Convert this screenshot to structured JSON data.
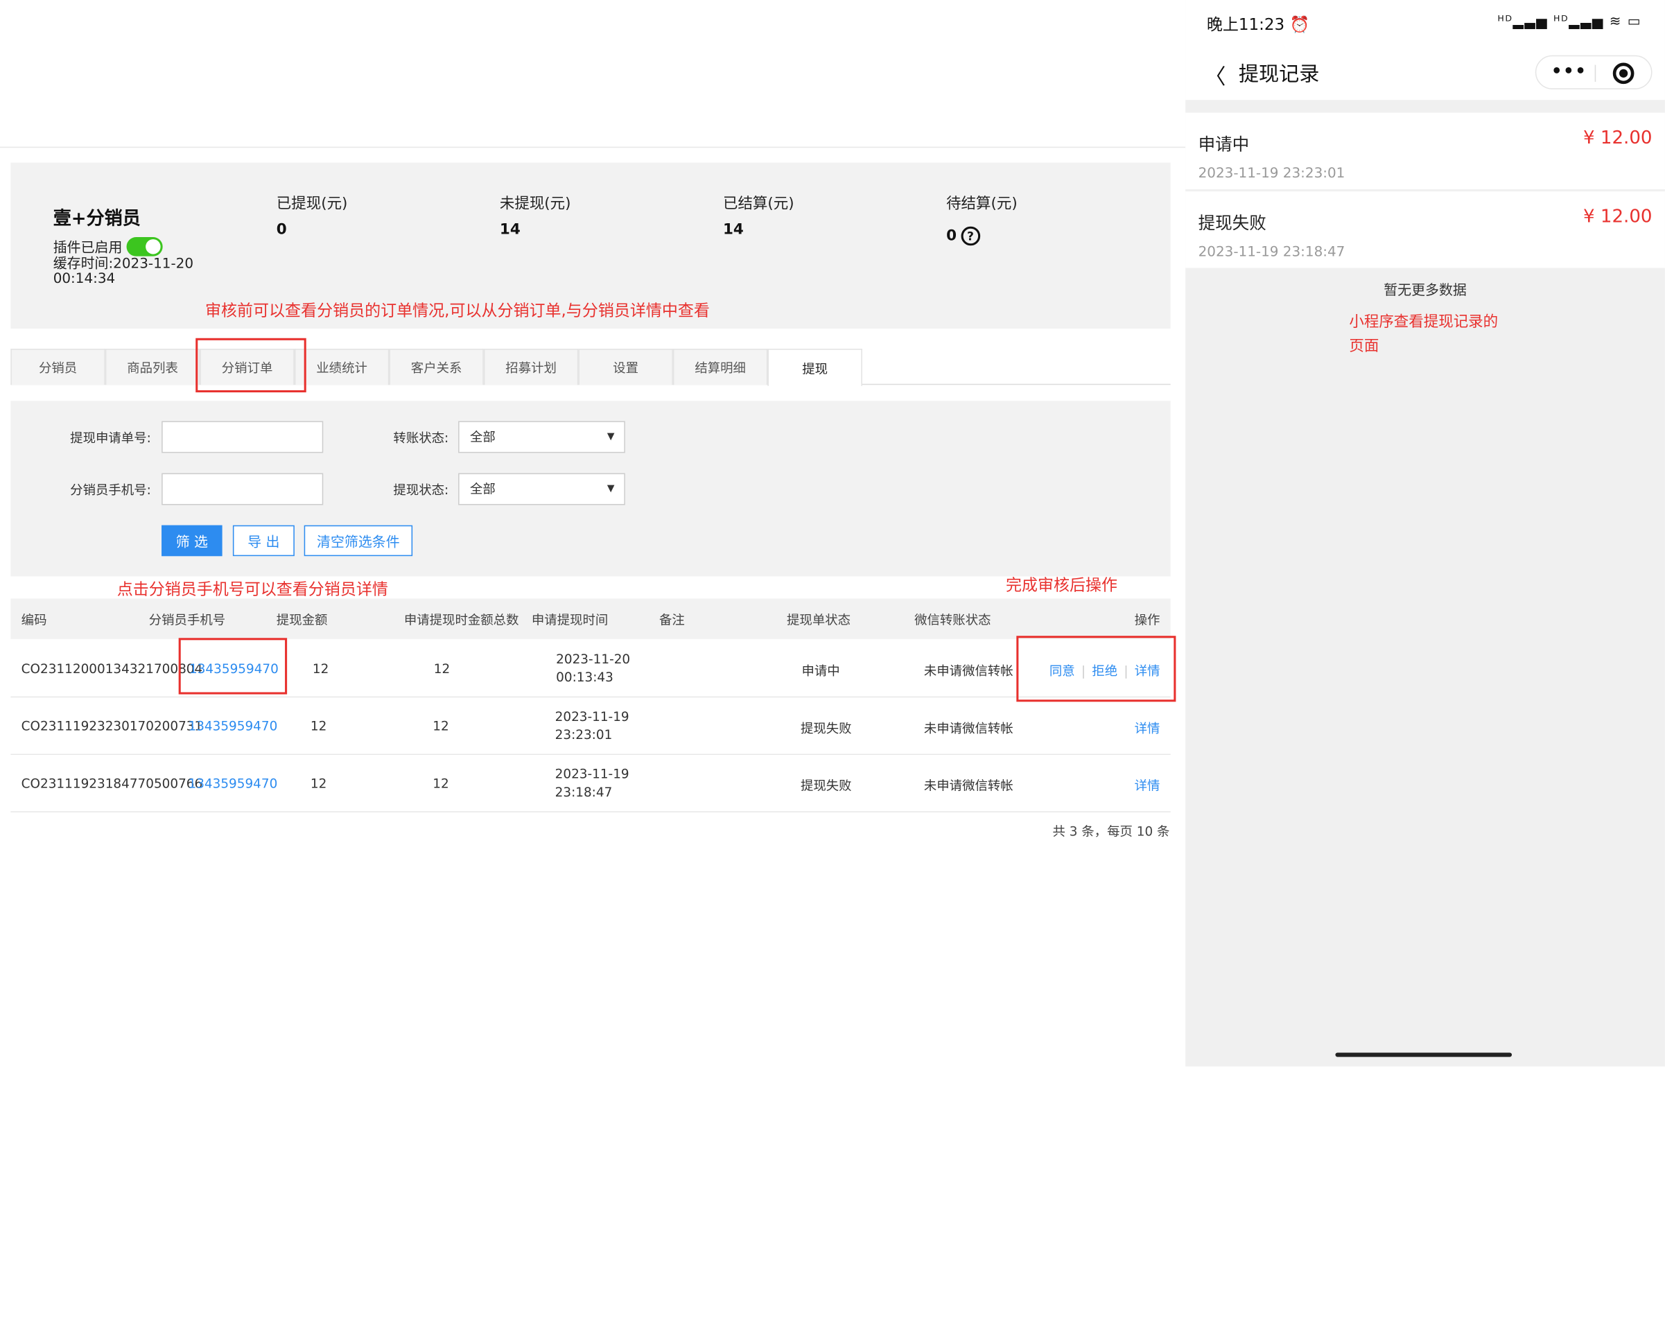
{
  "header": {
    "title": "壹+分销员",
    "plugin_label": "插件已启用",
    "plugin_enabled": true,
    "cache_time": "缓存时间:2023-11-20 00:14:34",
    "stats": [
      {
        "label": "已提现(元)",
        "value": "0"
      },
      {
        "label": "未提现(元)",
        "value": "14"
      },
      {
        "label": "已结算(元)",
        "value": "14"
      },
      {
        "label": "待结算(元)",
        "value": "0"
      }
    ]
  },
  "annotations": {
    "top_note": "审核前可以查看分销员的订单情况,可以从分销订单,与分销员详情中查看",
    "phone_note": "点击分销员手机号可以查看分销员详情",
    "action_note": "完成审核后操作",
    "mini_note_line1": "小程序查看提现记录的",
    "mini_note_line2": "页面"
  },
  "tabs": [
    "分销员",
    "商品列表",
    "分销订单",
    "业绩统计",
    "客户关系",
    "招募计划",
    "设置",
    "结算明细",
    "提现"
  ],
  "active_tab": "提现",
  "filter": {
    "apply_no_label": "提现申请单号:",
    "phone_label": "分销员手机号:",
    "transfer_status_label": "转账状态:",
    "transfer_status_value": "全部",
    "withdraw_status_label": "提现状态:",
    "withdraw_status_value": "全部",
    "btn_filter": "筛 选",
    "btn_export": "导 出",
    "btn_clear": "清空筛选条件"
  },
  "table": {
    "columns": [
      "编码",
      "分销员手机号",
      "提现金额",
      "申请提现时金额总数",
      "申请提现时间",
      "备注",
      "提现单状态",
      "微信转账状态",
      "操作"
    ],
    "rows": [
      {
        "code": "CO23112000134321700804",
        "phone": "13435959470",
        "amount": "12",
        "total": "12",
        "date": "2023-11-20",
        "time": "00:13:43",
        "remark": "",
        "status": "申请中",
        "wx_status": "未申请微信转帐",
        "actions": [
          "同意",
          "拒绝",
          "详情"
        ]
      },
      {
        "code": "CO23111923230170200731",
        "phone": "13435959470",
        "amount": "12",
        "total": "12",
        "date": "2023-11-19",
        "time": "23:23:01",
        "remark": "",
        "status": "提现失败",
        "wx_status": "未申请微信转帐",
        "actions": [
          "详情"
        ]
      },
      {
        "code": "CO23111923184770500766",
        "phone": "13435959470",
        "amount": "12",
        "total": "12",
        "date": "2023-11-19",
        "time": "23:18:47",
        "remark": "",
        "status": "提现失败",
        "wx_status": "未申请微信转帐",
        "actions": [
          "详情"
        ]
      }
    ],
    "pager": "共 3 条，每页 10 条"
  },
  "phone": {
    "status_time": "晚上11:23",
    "status_icons": "ᴴᴰ▂▃▅ ᴴᴰ▂▃▅ ≋ ▭",
    "alarm_icon": "⏰",
    "title": "提现记录",
    "records": [
      {
        "status": "申请中",
        "amount": "¥ 12.00",
        "time": "2023-11-19 23:23:01"
      },
      {
        "status": "提现失败",
        "amount": "¥ 12.00",
        "time": "2023-11-19 23:18:47"
      }
    ],
    "no_more": "暂无更多数据"
  },
  "colors": {
    "accent": "#2d8cf0",
    "annotation": "#e8312e",
    "toggle_on": "#3cc51f"
  }
}
